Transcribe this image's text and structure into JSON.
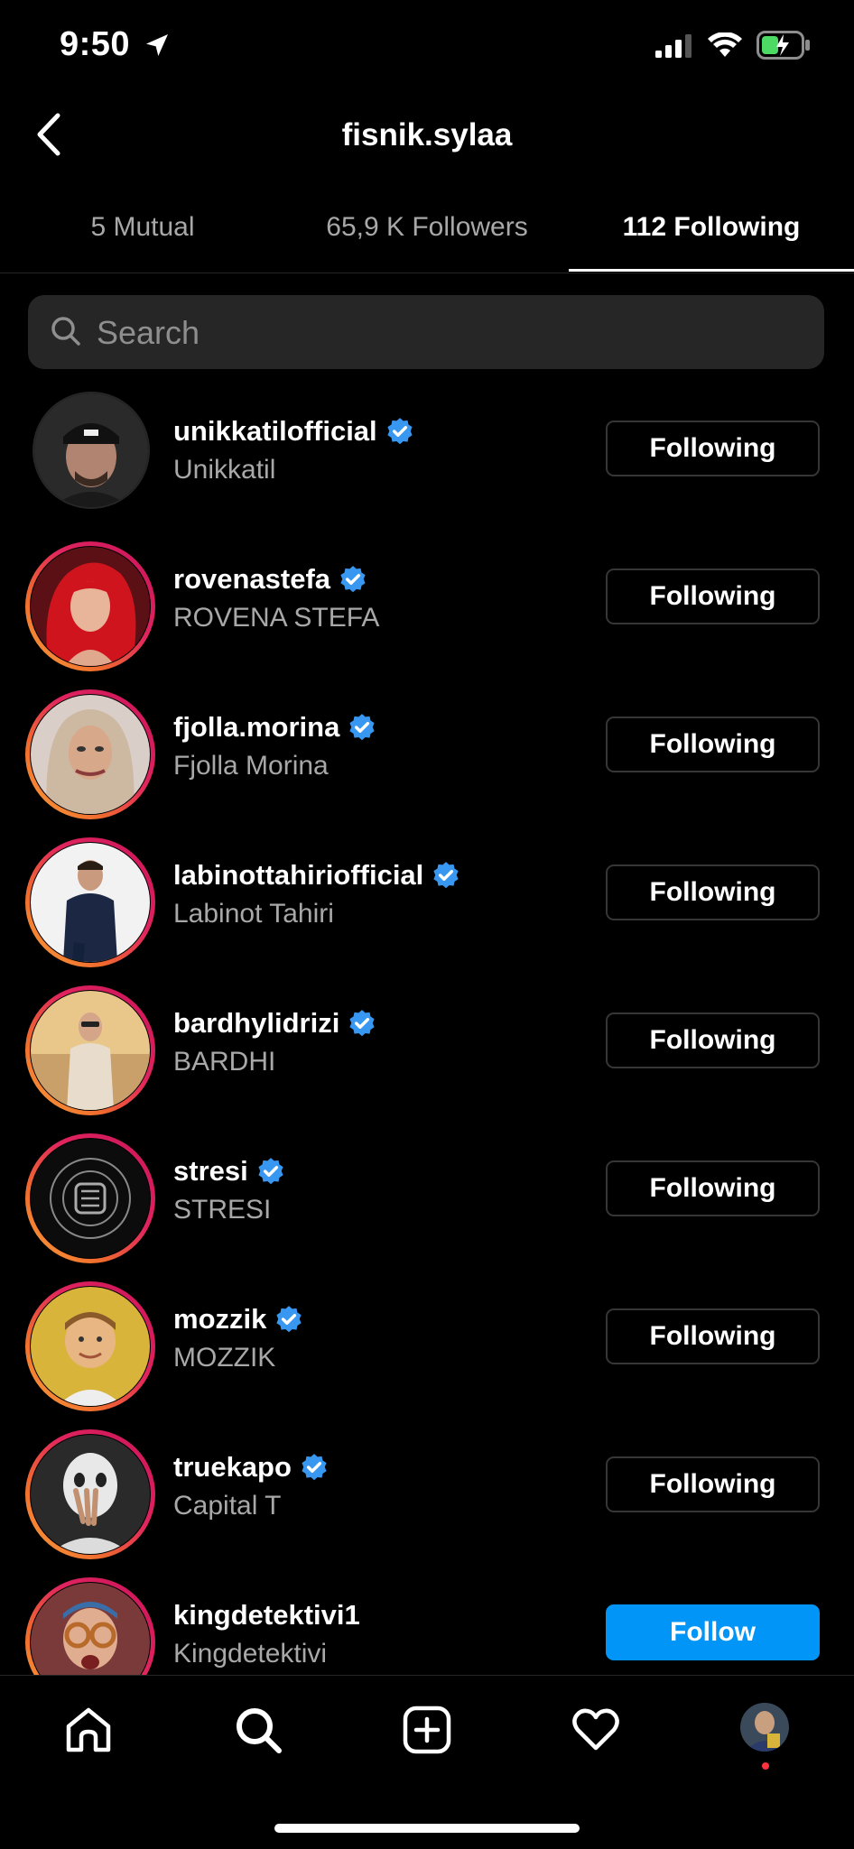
{
  "status_bar": {
    "time": "9:50"
  },
  "header": {
    "title": "fisnik.sylaa"
  },
  "tabs": [
    {
      "label": "5 Mutual",
      "active": false
    },
    {
      "label": "65,9 K Followers",
      "active": false
    },
    {
      "label": "112 Following",
      "active": true
    }
  ],
  "search": {
    "placeholder": "Search",
    "value": ""
  },
  "users": [
    {
      "username": "unikkatilofficial",
      "fullname": "Unikkatil",
      "verified": true,
      "button": "Following",
      "story_ring": false
    },
    {
      "username": "rovenastefa",
      "fullname": "ROVENA STEFA",
      "verified": true,
      "button": "Following",
      "story_ring": true
    },
    {
      "username": "fjolla.morina",
      "fullname": "Fjolla Morina",
      "verified": true,
      "button": "Following",
      "story_ring": true
    },
    {
      "username": "labinottahiriofficial",
      "fullname": "Labinot Tahiri",
      "verified": true,
      "button": "Following",
      "story_ring": true
    },
    {
      "username": "bardhylidrizi",
      "fullname": "BARDHI",
      "verified": true,
      "button": "Following",
      "story_ring": true
    },
    {
      "username": "stresi",
      "fullname": "STRESI",
      "verified": true,
      "button": "Following",
      "story_ring": true
    },
    {
      "username": "mozzik",
      "fullname": "MOZZIK",
      "verified": true,
      "button": "Following",
      "story_ring": true
    },
    {
      "username": "truekapo",
      "fullname": "Capital T",
      "verified": true,
      "button": "Following",
      "story_ring": true
    },
    {
      "username": "kingdetektivi1",
      "fullname": "Kingdetektivi",
      "verified": false,
      "button": "Follow",
      "story_ring": true
    }
  ],
  "colors": {
    "verified": "#3897f0",
    "follow_button": "#0095f6",
    "notification_dot": "#ff3040"
  },
  "nav": [
    "home-icon",
    "search-icon",
    "create-icon",
    "activity-heart-icon",
    "profile-avatar"
  ]
}
